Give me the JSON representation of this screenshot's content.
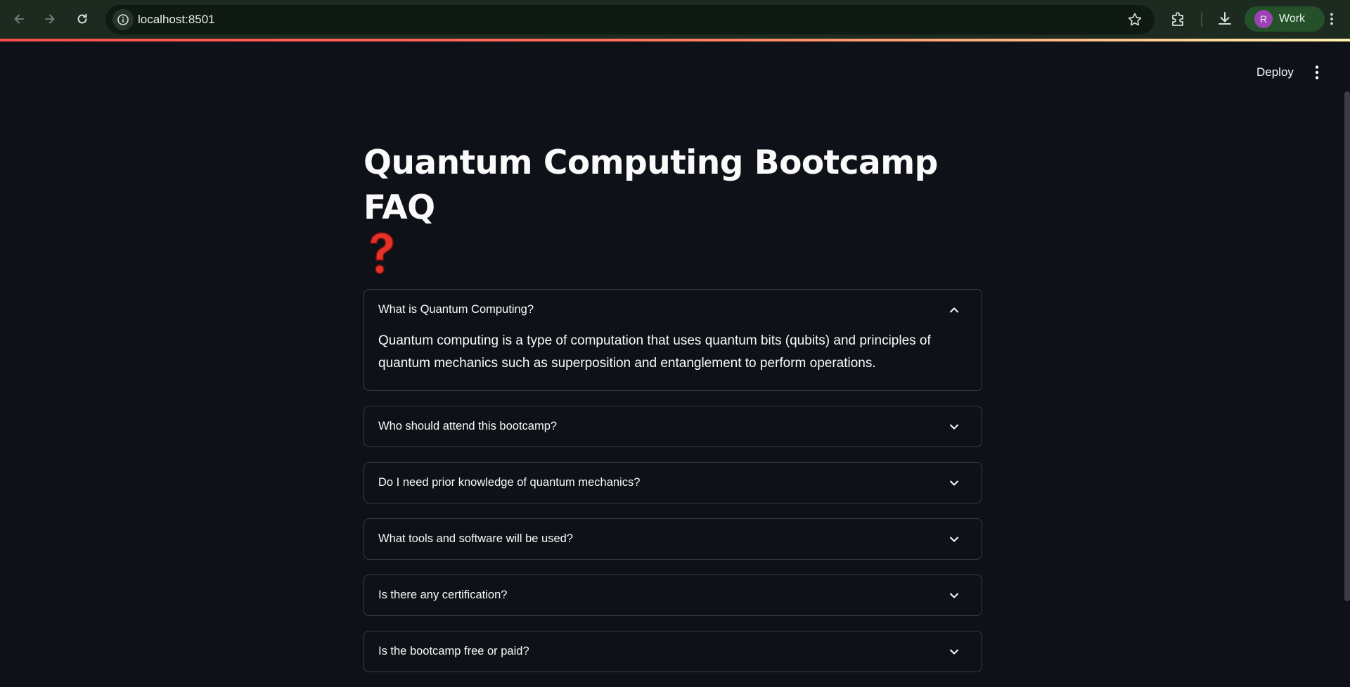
{
  "browser": {
    "url": "localhost:8501",
    "profile_initial": "R",
    "profile_name": "Work"
  },
  "app": {
    "deploy_label": "Deploy",
    "title": "Quantum Computing Bootcamp FAQ",
    "title_emoji": "question-mark-icon"
  },
  "faq": [
    {
      "question": "What is Quantum Computing?",
      "expanded": true,
      "answer": "Quantum computing is a type of computation that uses quantum bits (qubits) and principles of quantum mechanics such as superposition and entanglement to perform operations."
    },
    {
      "question": "Who should attend this bootcamp?",
      "expanded": false
    },
    {
      "question": "Do I need prior knowledge of quantum mechanics?",
      "expanded": false
    },
    {
      "question": "What tools and software will be used?",
      "expanded": false
    },
    {
      "question": "Is there any certification?",
      "expanded": false
    },
    {
      "question": "Is the bootcamp free or paid?",
      "expanded": false
    }
  ],
  "colors": {
    "background": "#0e1117",
    "accent": "#ff4b4b",
    "border": "#3a3c44",
    "text": "#fafafa"
  }
}
